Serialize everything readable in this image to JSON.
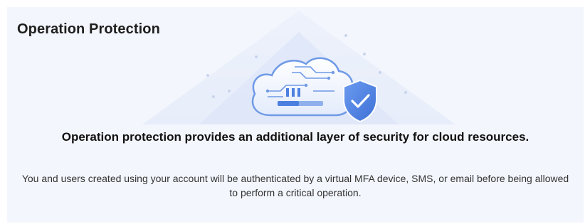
{
  "panel": {
    "title": "Operation Protection",
    "illustration_icon": "cloud-shield-icon",
    "headline": "Operation protection provides an additional layer of security for cloud resources.",
    "description": "You and users created using your account will be authenticated by a virtual MFA device, SMS, or email before being allowed to perform a critical operation."
  },
  "colors": {
    "panel_background": "#f3f6fc",
    "illustration_blue": "#5a8ee8",
    "shield_blue": "#4d7fe0",
    "headline_text": "#111111",
    "body_text": "#333333"
  }
}
